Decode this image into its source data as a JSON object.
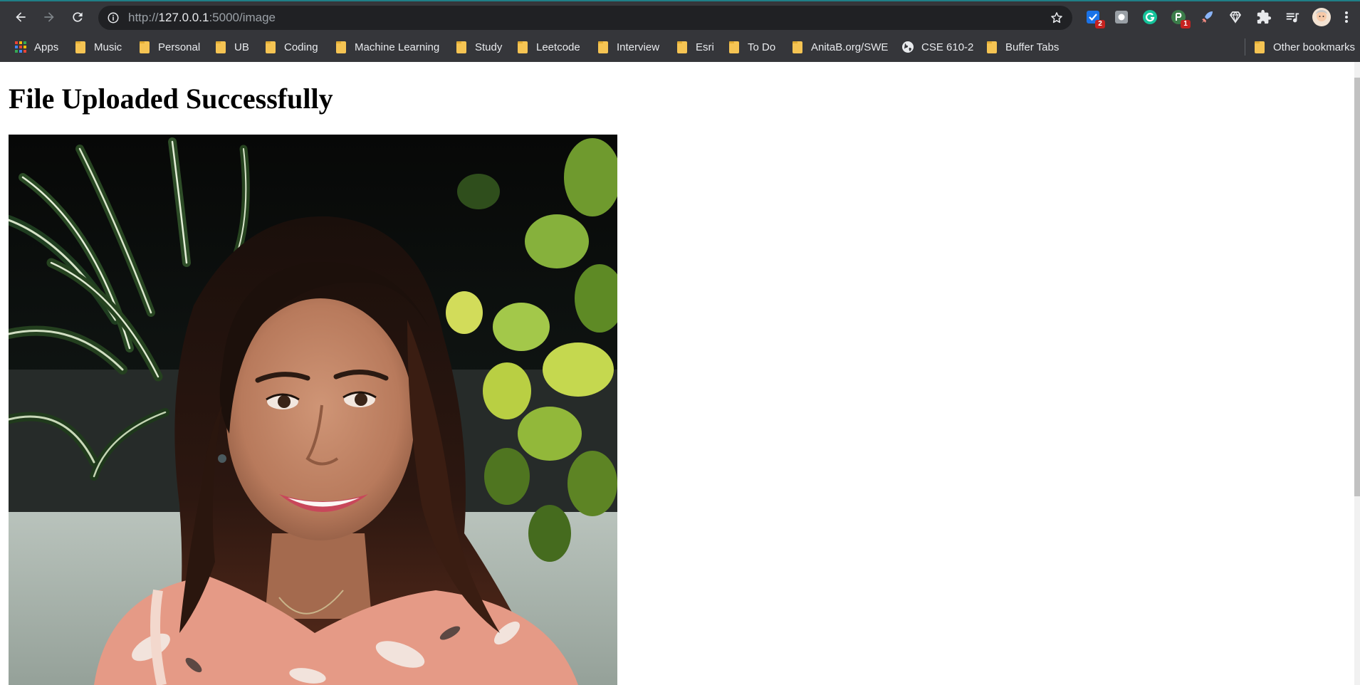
{
  "browser": {
    "url_scheme": "http://",
    "url_host": "127.0.0.1",
    "url_rest": ":5000/image",
    "extensions": [
      {
        "name": "todo-check-icon",
        "badge": "2"
      },
      {
        "name": "screenshot-icon",
        "badge": ""
      },
      {
        "name": "grammarly-icon",
        "badge": ""
      },
      {
        "name": "tracker-icon",
        "badge": "1"
      },
      {
        "name": "rocket-icon",
        "badge": ""
      },
      {
        "name": "diamond-icon",
        "badge": ""
      },
      {
        "name": "puzzle-icon",
        "badge": ""
      },
      {
        "name": "playlist-icon",
        "badge": ""
      }
    ],
    "accent_color": "#1f7f87"
  },
  "bookmarks": {
    "apps_label": "Apps",
    "items": [
      "Music",
      "Personal",
      "UB",
      "Coding",
      "Machine Learning",
      "Study",
      "Leetcode",
      "Interview",
      "Esri",
      "To Do",
      "AnitaB.org/SWE",
      "CSE 610-2",
      "Buffer Tabs"
    ],
    "other_label": "Other bookmarks"
  },
  "page": {
    "title": "File Uploaded Successfully",
    "image_alt": "uploaded-photo"
  }
}
